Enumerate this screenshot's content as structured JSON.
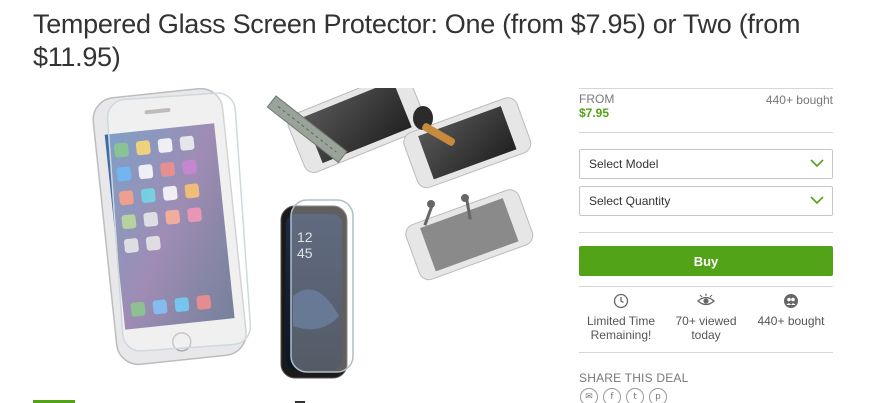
{
  "deal": {
    "title": "Tempered Glass Screen Protector: One (from $7.95) or Two (from $11.95)"
  },
  "pricing": {
    "from_label": "FROM",
    "price": "$7.95",
    "bought": "440+ bought"
  },
  "options": {
    "model_label": "Select Model",
    "quantity_label": "Select Quantity"
  },
  "buy_label": "Buy",
  "stats": {
    "time_line1": "Limited Time",
    "time_line2": "Remaining!",
    "viewed_line1": "70+ viewed",
    "viewed_line2": "today",
    "bought": "440+ bought"
  },
  "share": {
    "label": "SHARE THIS DEAL",
    "icons": [
      "mail-icon",
      "facebook-icon",
      "twitter-icon",
      "pinterest-icon"
    ]
  },
  "colors": {
    "accent": "#53a318",
    "muted_text": "#75787b"
  }
}
